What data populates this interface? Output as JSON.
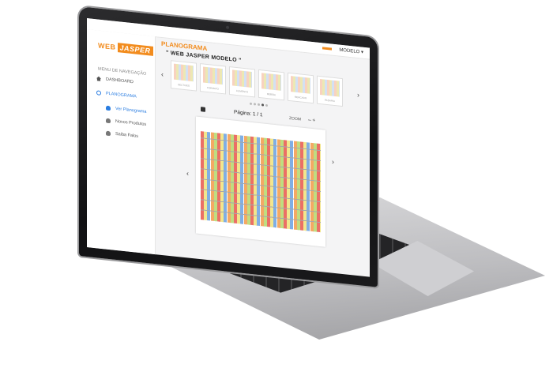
{
  "header": {
    "model_select": "MODELO ▾"
  },
  "logo": {
    "web": "WEB",
    "jasper": "JASPER"
  },
  "sidebar": {
    "heading": "MENU DE NAVEGAÇÃO",
    "items": [
      {
        "label": "DASHBOARD",
        "icon": "home-icon"
      },
      {
        "label": "PLANOGRAMA",
        "icon": "grid-icon"
      },
      {
        "label": "Ver Planograma",
        "icon": "user-icon"
      },
      {
        "label": "Novos Produtos",
        "icon": "user-icon"
      },
      {
        "label": "Saiba Falos",
        "icon": "user-icon"
      }
    ]
  },
  "main": {
    "title": "PLANOGRAMA",
    "subtitle": "\" WEB JASPER MODELO \"",
    "carousel": {
      "prev": "‹",
      "next": "›",
      "thumbs": [
        "SECTIVES",
        "FORMATO",
        "ALIMENTO",
        "BEBIDA",
        "MERCADO",
        "PADARIA"
      ]
    },
    "page_label": "Página: 1 / 1",
    "zoom_label": "ZOOM",
    "zoom_controls": "– +",
    "viewer_prev": "‹",
    "viewer_next": "›"
  },
  "colors": {
    "accent": "#f28c1e",
    "active": "#2a7de1"
  }
}
